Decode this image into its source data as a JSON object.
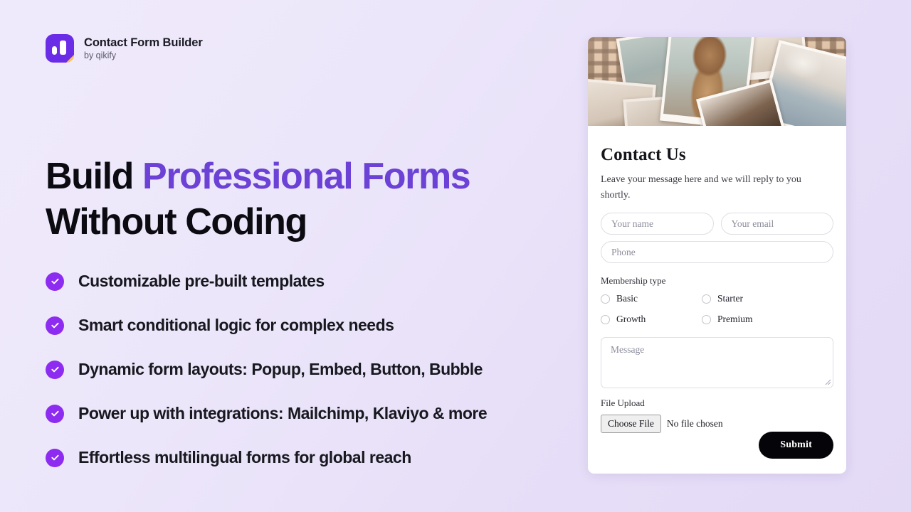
{
  "brand": {
    "title": "Contact Form Builder",
    "subtitle": "by qikify",
    "logo_icon": "bar-chart-logo-icon",
    "logo_color": "#6b2ce8",
    "logo_fold_color": "#fcc94a"
  },
  "hero": {
    "heading_lead": "Build ",
    "heading_accent": "Professional Forms",
    "heading_line2": "Without Coding",
    "accent_color": "#6c41d6"
  },
  "features": {
    "check_icon": "check-circle-icon",
    "check_color": "#8d2cf0",
    "items": [
      {
        "label": "Customizable pre-built templates"
      },
      {
        "label": "Smart conditional logic for complex needs"
      },
      {
        "label": "Dynamic form layouts:  Popup, Embed, Button, Bubble"
      },
      {
        "label": "Power up with integrations: Mailchimp, Klaviyo & more"
      },
      {
        "label": "Effortless multilingual forms for global reach"
      }
    ]
  },
  "form_card": {
    "hero_image_alt": "polaroid-photo-collage",
    "title": "Contact Us",
    "description": "Leave your message here and we will reply to you shortly.",
    "fields": {
      "name_placeholder": "Your name",
      "email_placeholder": "Your email",
      "phone_placeholder": "Phone",
      "message_placeholder": "Message",
      "name_value": "",
      "email_value": "",
      "phone_value": "",
      "message_value": ""
    },
    "membership": {
      "label": "Membership type",
      "options": [
        {
          "label": "Basic",
          "selected": false
        },
        {
          "label": "Starter",
          "selected": false
        },
        {
          "label": "Growth",
          "selected": false
        },
        {
          "label": "Premium",
          "selected": false
        }
      ]
    },
    "file_upload": {
      "label": "File Upload",
      "button_label": "Choose File",
      "status_text": "No file chosen"
    },
    "submit_label": "Submit",
    "submit_bg": "#050509"
  }
}
